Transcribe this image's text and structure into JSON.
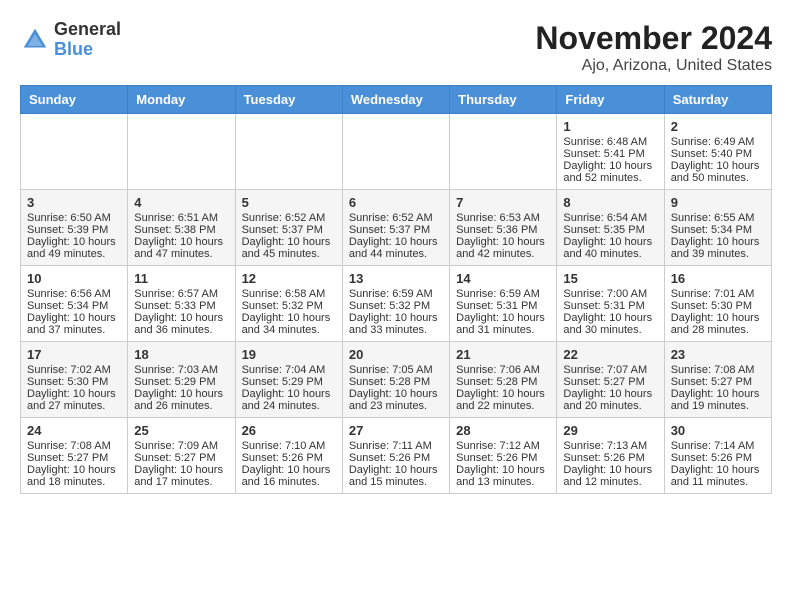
{
  "header": {
    "logo_line1": "General",
    "logo_line2": "Blue",
    "title": "November 2024",
    "subtitle": "Ajo, Arizona, United States"
  },
  "weekdays": [
    "Sunday",
    "Monday",
    "Tuesday",
    "Wednesday",
    "Thursday",
    "Friday",
    "Saturday"
  ],
  "weeks": [
    [
      {
        "day": "",
        "sunrise": "",
        "sunset": "",
        "daylight": ""
      },
      {
        "day": "",
        "sunrise": "",
        "sunset": "",
        "daylight": ""
      },
      {
        "day": "",
        "sunrise": "",
        "sunset": "",
        "daylight": ""
      },
      {
        "day": "",
        "sunrise": "",
        "sunset": "",
        "daylight": ""
      },
      {
        "day": "",
        "sunrise": "",
        "sunset": "",
        "daylight": ""
      },
      {
        "day": "1",
        "sunrise": "Sunrise: 6:48 AM",
        "sunset": "Sunset: 5:41 PM",
        "daylight": "Daylight: 10 hours and 52 minutes."
      },
      {
        "day": "2",
        "sunrise": "Sunrise: 6:49 AM",
        "sunset": "Sunset: 5:40 PM",
        "daylight": "Daylight: 10 hours and 50 minutes."
      }
    ],
    [
      {
        "day": "3",
        "sunrise": "Sunrise: 6:50 AM",
        "sunset": "Sunset: 5:39 PM",
        "daylight": "Daylight: 10 hours and 49 minutes."
      },
      {
        "day": "4",
        "sunrise": "Sunrise: 6:51 AM",
        "sunset": "Sunset: 5:38 PM",
        "daylight": "Daylight: 10 hours and 47 minutes."
      },
      {
        "day": "5",
        "sunrise": "Sunrise: 6:52 AM",
        "sunset": "Sunset: 5:37 PM",
        "daylight": "Daylight: 10 hours and 45 minutes."
      },
      {
        "day": "6",
        "sunrise": "Sunrise: 6:52 AM",
        "sunset": "Sunset: 5:37 PM",
        "daylight": "Daylight: 10 hours and 44 minutes."
      },
      {
        "day": "7",
        "sunrise": "Sunrise: 6:53 AM",
        "sunset": "Sunset: 5:36 PM",
        "daylight": "Daylight: 10 hours and 42 minutes."
      },
      {
        "day": "8",
        "sunrise": "Sunrise: 6:54 AM",
        "sunset": "Sunset: 5:35 PM",
        "daylight": "Daylight: 10 hours and 40 minutes."
      },
      {
        "day": "9",
        "sunrise": "Sunrise: 6:55 AM",
        "sunset": "Sunset: 5:34 PM",
        "daylight": "Daylight: 10 hours and 39 minutes."
      }
    ],
    [
      {
        "day": "10",
        "sunrise": "Sunrise: 6:56 AM",
        "sunset": "Sunset: 5:34 PM",
        "daylight": "Daylight: 10 hours and 37 minutes."
      },
      {
        "day": "11",
        "sunrise": "Sunrise: 6:57 AM",
        "sunset": "Sunset: 5:33 PM",
        "daylight": "Daylight: 10 hours and 36 minutes."
      },
      {
        "day": "12",
        "sunrise": "Sunrise: 6:58 AM",
        "sunset": "Sunset: 5:32 PM",
        "daylight": "Daylight: 10 hours and 34 minutes."
      },
      {
        "day": "13",
        "sunrise": "Sunrise: 6:59 AM",
        "sunset": "Sunset: 5:32 PM",
        "daylight": "Daylight: 10 hours and 33 minutes."
      },
      {
        "day": "14",
        "sunrise": "Sunrise: 6:59 AM",
        "sunset": "Sunset: 5:31 PM",
        "daylight": "Daylight: 10 hours and 31 minutes."
      },
      {
        "day": "15",
        "sunrise": "Sunrise: 7:00 AM",
        "sunset": "Sunset: 5:31 PM",
        "daylight": "Daylight: 10 hours and 30 minutes."
      },
      {
        "day": "16",
        "sunrise": "Sunrise: 7:01 AM",
        "sunset": "Sunset: 5:30 PM",
        "daylight": "Daylight: 10 hours and 28 minutes."
      }
    ],
    [
      {
        "day": "17",
        "sunrise": "Sunrise: 7:02 AM",
        "sunset": "Sunset: 5:30 PM",
        "daylight": "Daylight: 10 hours and 27 minutes."
      },
      {
        "day": "18",
        "sunrise": "Sunrise: 7:03 AM",
        "sunset": "Sunset: 5:29 PM",
        "daylight": "Daylight: 10 hours and 26 minutes."
      },
      {
        "day": "19",
        "sunrise": "Sunrise: 7:04 AM",
        "sunset": "Sunset: 5:29 PM",
        "daylight": "Daylight: 10 hours and 24 minutes."
      },
      {
        "day": "20",
        "sunrise": "Sunrise: 7:05 AM",
        "sunset": "Sunset: 5:28 PM",
        "daylight": "Daylight: 10 hours and 23 minutes."
      },
      {
        "day": "21",
        "sunrise": "Sunrise: 7:06 AM",
        "sunset": "Sunset: 5:28 PM",
        "daylight": "Daylight: 10 hours and 22 minutes."
      },
      {
        "day": "22",
        "sunrise": "Sunrise: 7:07 AM",
        "sunset": "Sunset: 5:27 PM",
        "daylight": "Daylight: 10 hours and 20 minutes."
      },
      {
        "day": "23",
        "sunrise": "Sunrise: 7:08 AM",
        "sunset": "Sunset: 5:27 PM",
        "daylight": "Daylight: 10 hours and 19 minutes."
      }
    ],
    [
      {
        "day": "24",
        "sunrise": "Sunrise: 7:08 AM",
        "sunset": "Sunset: 5:27 PM",
        "daylight": "Daylight: 10 hours and 18 minutes."
      },
      {
        "day": "25",
        "sunrise": "Sunrise: 7:09 AM",
        "sunset": "Sunset: 5:27 PM",
        "daylight": "Daylight: 10 hours and 17 minutes."
      },
      {
        "day": "26",
        "sunrise": "Sunrise: 7:10 AM",
        "sunset": "Sunset: 5:26 PM",
        "daylight": "Daylight: 10 hours and 16 minutes."
      },
      {
        "day": "27",
        "sunrise": "Sunrise: 7:11 AM",
        "sunset": "Sunset: 5:26 PM",
        "daylight": "Daylight: 10 hours and 15 minutes."
      },
      {
        "day": "28",
        "sunrise": "Sunrise: 7:12 AM",
        "sunset": "Sunset: 5:26 PM",
        "daylight": "Daylight: 10 hours and 13 minutes."
      },
      {
        "day": "29",
        "sunrise": "Sunrise: 7:13 AM",
        "sunset": "Sunset: 5:26 PM",
        "daylight": "Daylight: 10 hours and 12 minutes."
      },
      {
        "day": "30",
        "sunrise": "Sunrise: 7:14 AM",
        "sunset": "Sunset: 5:26 PM",
        "daylight": "Daylight: 10 hours and 11 minutes."
      }
    ]
  ]
}
